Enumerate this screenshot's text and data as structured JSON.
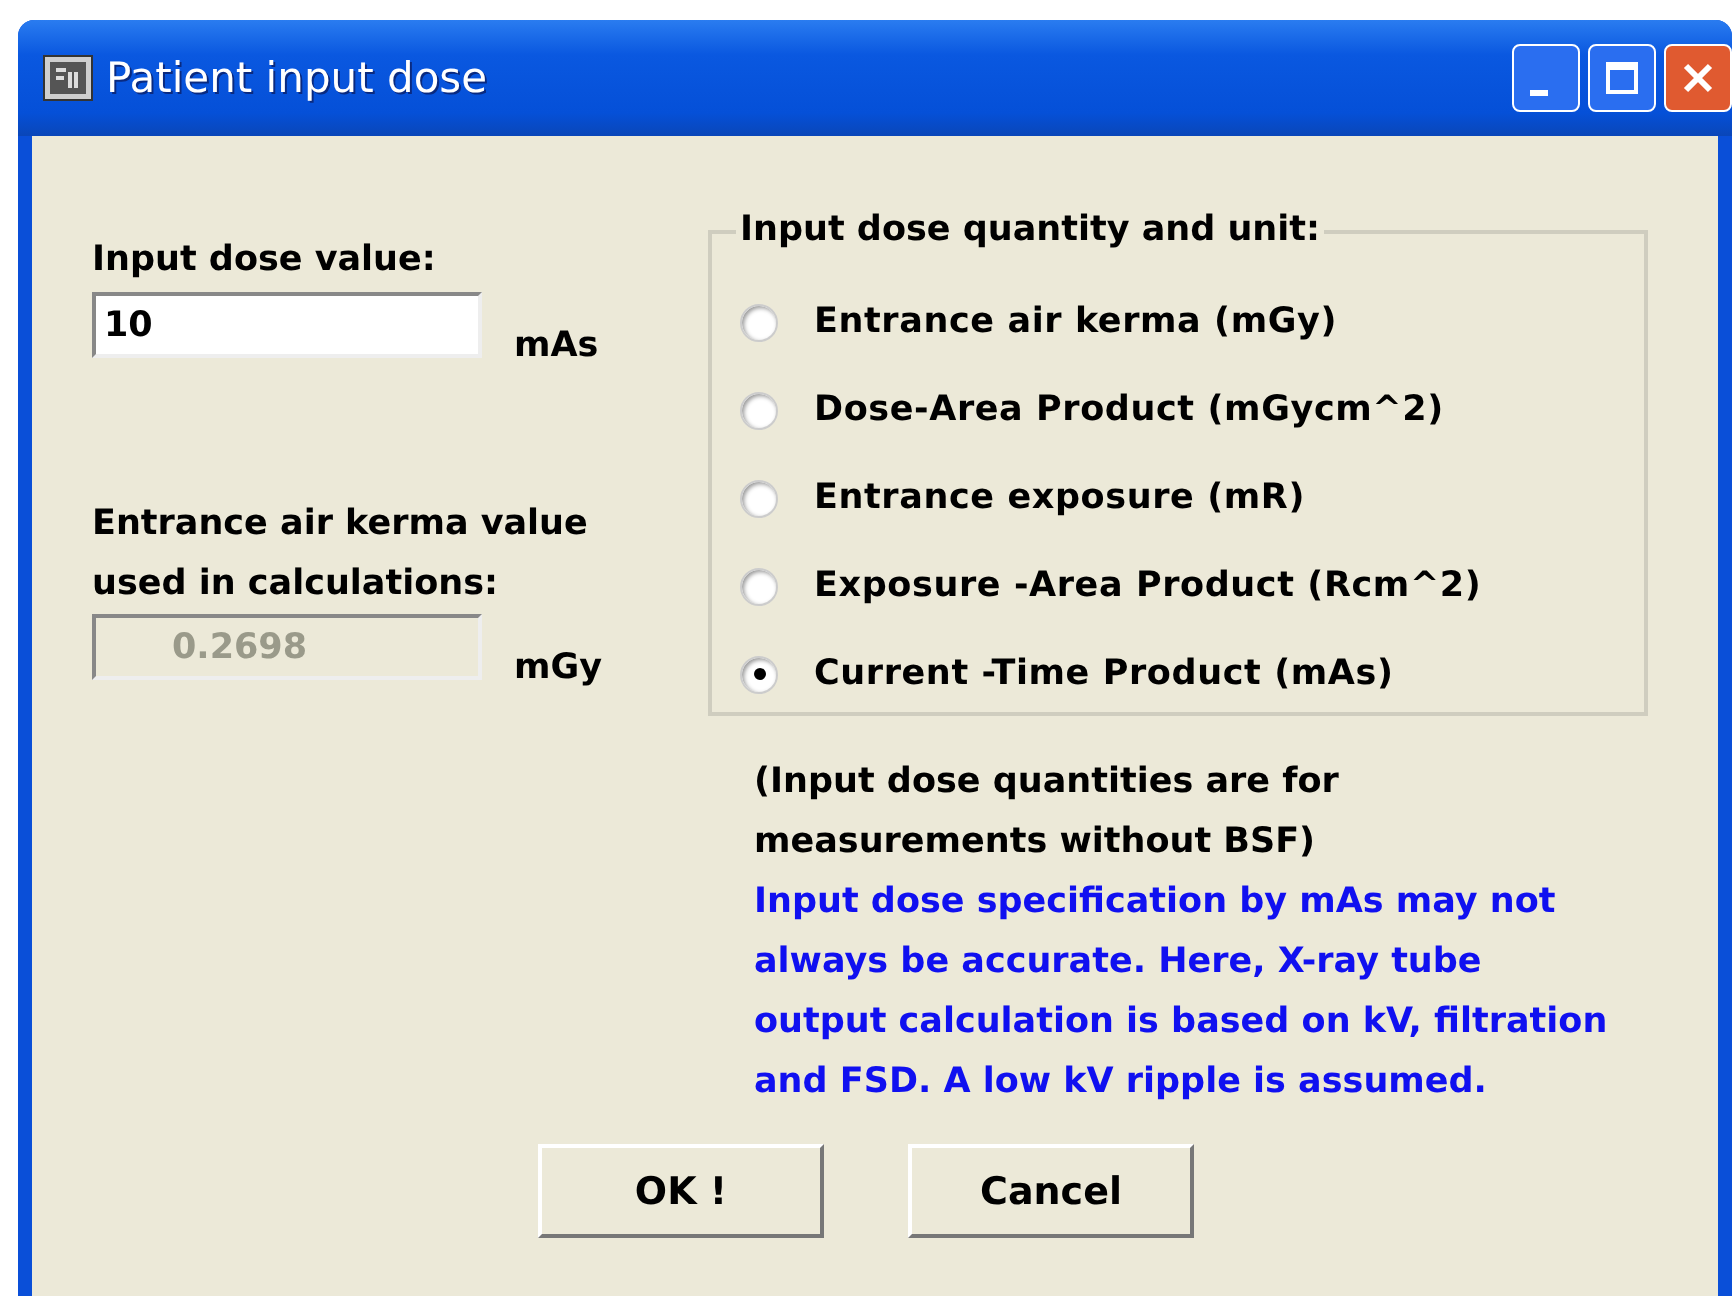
{
  "window": {
    "title": "Patient input dose"
  },
  "input_dose": {
    "label": "Input dose value:",
    "value": "10",
    "unit": "mAs"
  },
  "kerma": {
    "label_lines": [
      "Entrance air kerma value",
      "used in calculations:"
    ],
    "value": "0.2698",
    "unit": "mGy",
    "disabled": true
  },
  "quantity_group": {
    "title": "Input dose quantity and unit:",
    "options": [
      {
        "label": "Entrance air kerma (mGy)",
        "selected": false
      },
      {
        "label": "Dose-Area Product (mGycm^2)",
        "selected": false
      },
      {
        "label": "Entrance exposure (mR)",
        "selected": false
      },
      {
        "label": "Exposure -Area Product (Rcm^2)",
        "selected": false
      },
      {
        "label": "Current -Time Product (mAs)",
        "selected": true
      }
    ]
  },
  "notes": [
    {
      "kind": "info",
      "lines": [
        "(Input dose quantities are for",
        "measurements without BSF)"
      ]
    },
    {
      "kind": "warning",
      "lines": [
        "Input dose specification by mAs may not",
        "always be accurate. Here, X-ray tube",
        "output calculation is based on kV, filtration",
        "and FSD. A low kV ripple is assumed."
      ]
    }
  ],
  "buttons": [
    "OK !",
    "Cancel"
  ]
}
